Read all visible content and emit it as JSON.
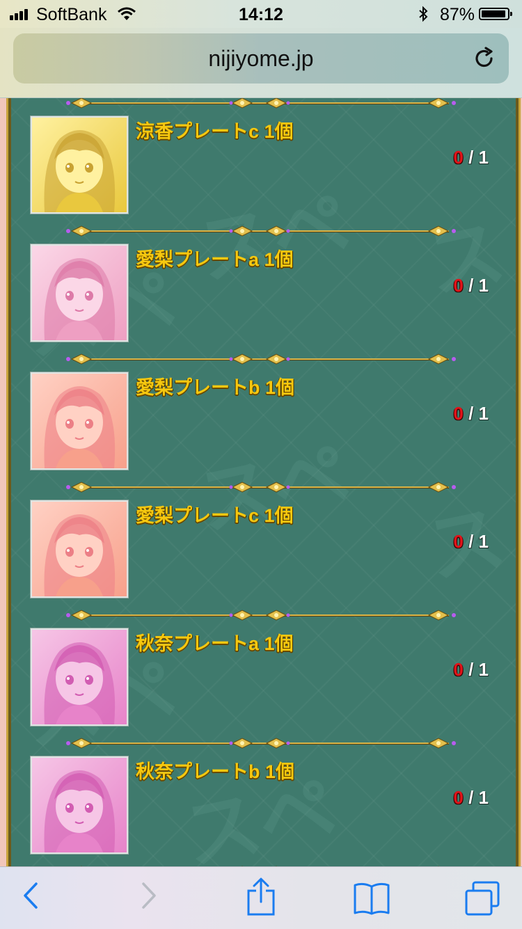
{
  "status_bar": {
    "carrier": "SoftBank",
    "time": "14:12",
    "battery": "87%",
    "icons": [
      "signal-icon",
      "wifi-icon",
      "bluetooth-icon",
      "battery-icon"
    ]
  },
  "browser": {
    "url": "nijiyome.jp",
    "reload_icon": "reload-icon",
    "toolbar_icons": [
      "back-icon",
      "forward-icon",
      "share-icon",
      "bookmarks-icon",
      "tabs-icon"
    ]
  },
  "colors": {
    "panel": "#3f7a6d",
    "item_name": "#f6c80f",
    "owned_count": "#e0141a"
  },
  "items": [
    {
      "name": "涼香プレートc 1個",
      "have": "0",
      "sep": "/",
      "need": "1",
      "tint": "yellow"
    },
    {
      "name": "愛梨プレートa 1個",
      "have": "0",
      "sep": "/",
      "need": "1",
      "tint": "pink"
    },
    {
      "name": "愛梨プレートb 1個",
      "have": "0",
      "sep": "/",
      "need": "1",
      "tint": "orange"
    },
    {
      "name": "愛梨プレートc 1個",
      "have": "0",
      "sep": "/",
      "need": "1",
      "tint": "orange"
    },
    {
      "name": "秋奈プレートa 1個",
      "have": "0",
      "sep": "/",
      "need": "1",
      "tint": "magenta"
    },
    {
      "name": "秋奈プレートb 1個",
      "have": "0",
      "sep": "/",
      "need": "1",
      "tint": "magenta"
    }
  ]
}
